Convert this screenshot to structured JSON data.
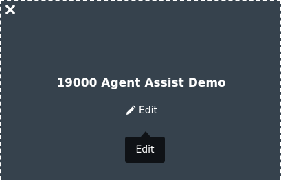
{
  "panel": {
    "background_color": "#36424d",
    "border_color": "#ffffff"
  },
  "close": {
    "icon": "close-icon"
  },
  "title": "19000 Agent Assist Demo",
  "edit": {
    "icon": "pencil-icon",
    "label": "Edit"
  },
  "tooltip": {
    "text": "Edit",
    "background_color": "#0f1216"
  }
}
